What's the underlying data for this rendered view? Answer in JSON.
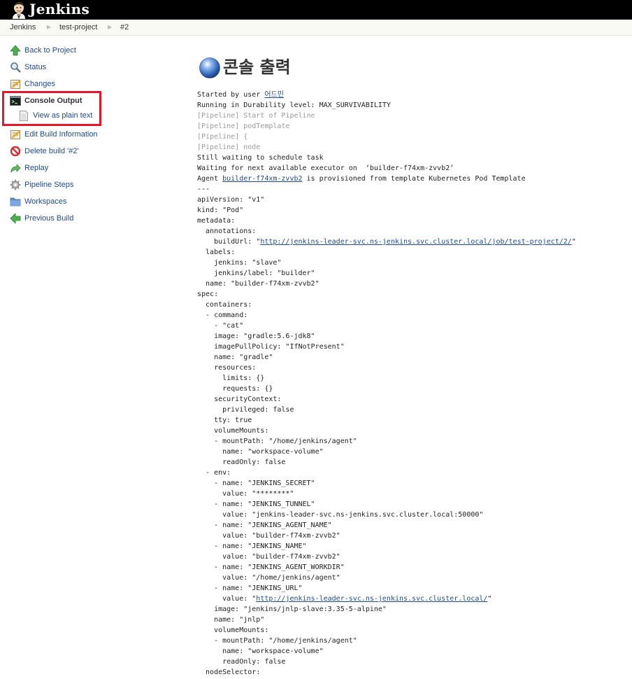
{
  "header": {
    "logo_text": "Jenkins"
  },
  "breadcrumbs": [
    "Jenkins",
    "test-project",
    "#2"
  ],
  "sidebar": {
    "items": [
      {
        "label": "Back to Project",
        "icon": "up-arrow-icon"
      },
      {
        "label": "Status",
        "icon": "search-icon"
      },
      {
        "label": "Changes",
        "icon": "notepad-icon"
      },
      {
        "label": "Console Output",
        "icon": "terminal-icon"
      },
      {
        "label": "View as plain text",
        "icon": "document-icon"
      },
      {
        "label": "Edit Build Information",
        "icon": "notepad-icon"
      },
      {
        "label": "Delete build '#2'",
        "icon": "no-entry-icon"
      },
      {
        "label": "Replay",
        "icon": "redo-arrow-icon"
      },
      {
        "label": "Pipeline Steps",
        "icon": "gear-icon"
      },
      {
        "label": "Workspaces",
        "icon": "folder-icon"
      },
      {
        "label": "Previous Build",
        "icon": "left-arrow-icon"
      }
    ]
  },
  "page": {
    "title": "콘솔 출력"
  },
  "console": {
    "lines": [
      {
        "parts": [
          {
            "text": "Started by user "
          },
          {
            "text": "어드민",
            "link": true
          }
        ]
      },
      {
        "parts": [
          {
            "text": "Running in Durability level: MAX_SURVIVABILITY"
          }
        ]
      },
      {
        "pipe": true,
        "parts": [
          {
            "text": "[Pipeline] Start of Pipeline"
          }
        ]
      },
      {
        "pipe": true,
        "parts": [
          {
            "text": "[Pipeline] podTemplate"
          }
        ]
      },
      {
        "pipe": true,
        "parts": [
          {
            "text": "[Pipeline] {"
          }
        ]
      },
      {
        "pipe": true,
        "parts": [
          {
            "text": "[Pipeline] node"
          }
        ]
      },
      {
        "parts": [
          {
            "text": "Still waiting to schedule task"
          }
        ]
      },
      {
        "parts": [
          {
            "text": "Waiting for next available executor on  ‘builder-f74xm-zvvb2’"
          }
        ]
      },
      {
        "parts": [
          {
            "text": "Agent "
          },
          {
            "text": "builder-f74xm-zvvb2",
            "link": true
          },
          {
            "text": " is provisioned from template Kubernetes Pod Template"
          }
        ]
      },
      {
        "parts": [
          {
            "text": "---"
          }
        ]
      },
      {
        "parts": [
          {
            "text": "apiVersion: \"v1\""
          }
        ]
      },
      {
        "parts": [
          {
            "text": "kind: \"Pod\""
          }
        ]
      },
      {
        "parts": [
          {
            "text": "metadata:"
          }
        ]
      },
      {
        "parts": [
          {
            "text": "  annotations:"
          }
        ]
      },
      {
        "parts": [
          {
            "text": "    buildUrl: \""
          },
          {
            "text": "http://jenkins-leader-svc.ns-jenkins.svc.cluster.local/job/test-project/2/",
            "link": true
          },
          {
            "text": "\""
          }
        ]
      },
      {
        "parts": [
          {
            "text": "  labels:"
          }
        ]
      },
      {
        "parts": [
          {
            "text": "    jenkins: \"slave\""
          }
        ]
      },
      {
        "parts": [
          {
            "text": "    jenkins/label: \"builder\""
          }
        ]
      },
      {
        "parts": [
          {
            "text": "  name: \"builder-f74xm-zvvb2\""
          }
        ]
      },
      {
        "parts": [
          {
            "text": "spec:"
          }
        ]
      },
      {
        "parts": [
          {
            "text": "  containers:"
          }
        ]
      },
      {
        "parts": [
          {
            "text": "  - command:"
          }
        ]
      },
      {
        "parts": [
          {
            "text": "    - \"cat\""
          }
        ]
      },
      {
        "parts": [
          {
            "text": "    image: \"gradle:5.6-jdk8\""
          }
        ]
      },
      {
        "parts": [
          {
            "text": "    imagePullPolicy: \"IfNotPresent\""
          }
        ]
      },
      {
        "parts": [
          {
            "text": "    name: \"gradle\""
          }
        ]
      },
      {
        "parts": [
          {
            "text": "    resources:"
          }
        ]
      },
      {
        "parts": [
          {
            "text": "      limits: {}"
          }
        ]
      },
      {
        "parts": [
          {
            "text": "      requests: {}"
          }
        ]
      },
      {
        "parts": [
          {
            "text": "    securityContext:"
          }
        ]
      },
      {
        "parts": [
          {
            "text": "      privileged: false"
          }
        ]
      },
      {
        "parts": [
          {
            "text": "    tty: true"
          }
        ]
      },
      {
        "parts": [
          {
            "text": "    volumeMounts:"
          }
        ]
      },
      {
        "parts": [
          {
            "text": "    - mountPath: \"/home/jenkins/agent\""
          }
        ]
      },
      {
        "parts": [
          {
            "text": "      name: \"workspace-volume\""
          }
        ]
      },
      {
        "parts": [
          {
            "text": "      readOnly: false"
          }
        ]
      },
      {
        "parts": [
          {
            "text": "  - env:"
          }
        ]
      },
      {
        "parts": [
          {
            "text": "    - name: \"JENKINS_SECRET\""
          }
        ]
      },
      {
        "parts": [
          {
            "text": "      value: \"********\""
          }
        ]
      },
      {
        "parts": [
          {
            "text": "    - name: \"JENKINS_TUNNEL\""
          }
        ]
      },
      {
        "parts": [
          {
            "text": "      value: \"jenkins-leader-svc.ns-jenkins.svc.cluster.local:50000\""
          }
        ]
      },
      {
        "parts": [
          {
            "text": "    - name: \"JENKINS_AGENT_NAME\""
          }
        ]
      },
      {
        "parts": [
          {
            "text": "      value: \"builder-f74xm-zvvb2\""
          }
        ]
      },
      {
        "parts": [
          {
            "text": "    - name: \"JENKINS_NAME\""
          }
        ]
      },
      {
        "parts": [
          {
            "text": "      value: \"builder-f74xm-zvvb2\""
          }
        ]
      },
      {
        "parts": [
          {
            "text": "    - name: \"JENKINS_AGENT_WORKDIR\""
          }
        ]
      },
      {
        "parts": [
          {
            "text": "      value: \"/home/jenkins/agent\""
          }
        ]
      },
      {
        "parts": [
          {
            "text": "    - name: \"JENKINS_URL\""
          }
        ]
      },
      {
        "parts": [
          {
            "text": "      value: \""
          },
          {
            "text": "http://jenkins-leader-svc.ns-jenkins.svc.cluster.local/",
            "link": true
          },
          {
            "text": "\""
          }
        ]
      },
      {
        "parts": [
          {
            "text": "    image: \"jenkins/jnlp-slave:3.35-5-alpine\""
          }
        ]
      },
      {
        "parts": [
          {
            "text": "    name: \"jnlp\""
          }
        ]
      },
      {
        "parts": [
          {
            "text": "    volumeMounts:"
          }
        ]
      },
      {
        "parts": [
          {
            "text": "    - mountPath: \"/home/jenkins/agent\""
          }
        ]
      },
      {
        "parts": [
          {
            "text": "      name: \"workspace-volume\""
          }
        ]
      },
      {
        "parts": [
          {
            "text": "      readOnly: false"
          }
        ]
      },
      {
        "parts": [
          {
            "text": "  nodeSelector:"
          }
        ]
      }
    ]
  }
}
